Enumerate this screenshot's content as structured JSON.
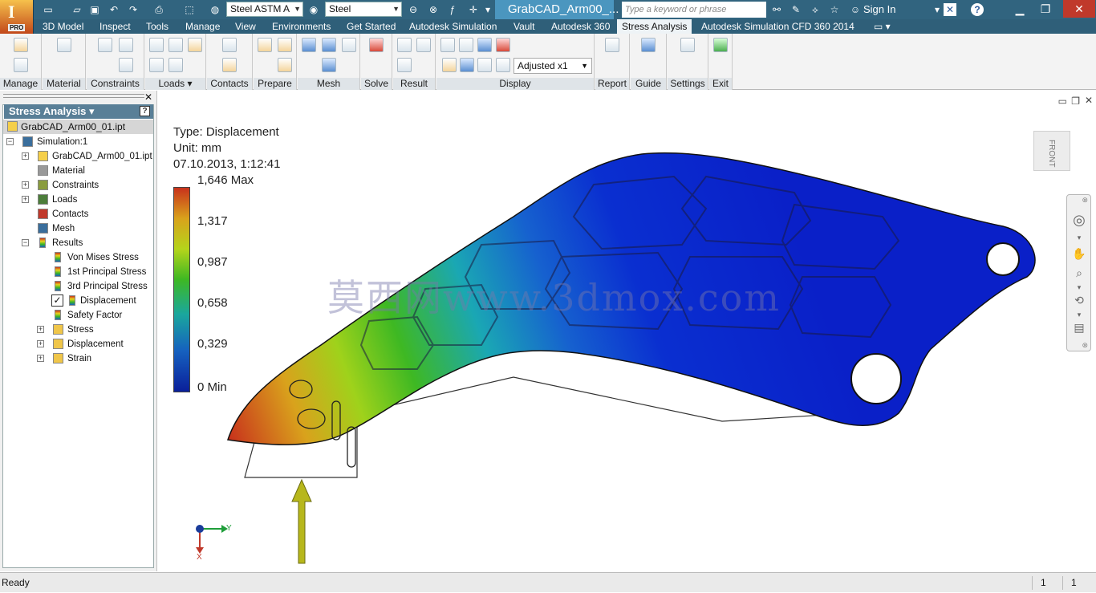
{
  "app": {
    "name": "Inventor",
    "edition": "PRO",
    "document_tab": "GrabCAD_Arm00_..."
  },
  "quick_access": {
    "material_combo": "Steel ASTM A",
    "appearance_combo": "Steel",
    "search_placeholder": "Type a keyword or phrase",
    "sign_in": "Sign In"
  },
  "menu": {
    "tabs": [
      "3D Model",
      "Inspect",
      "Tools",
      "Manage",
      "View",
      "Environments",
      "Get Started",
      "Autodesk Simulation",
      "Vault",
      "Autodesk 360",
      "Stress Analysis",
      "Autodesk Simulation CFD 360 2014"
    ],
    "active": "Stress Analysis"
  },
  "ribbon": {
    "panels": [
      "Manage",
      "Material",
      "Constraints",
      "Loads",
      "Contacts",
      "Prepare",
      "Mesh",
      "Solve",
      "Result",
      "Display",
      "Report",
      "Guide",
      "Settings",
      "Exit"
    ],
    "display_combo": "Adjusted x1"
  },
  "browser": {
    "title": "Stress Analysis",
    "help": "?",
    "root": "GrabCAD_Arm00_01.ipt",
    "nodes": {
      "simulation": "Simulation:1",
      "part": "GrabCAD_Arm00_01.ipt",
      "material": "Material",
      "constraints": "Constraints",
      "loads": "Loads",
      "contacts": "Contacts",
      "mesh": "Mesh",
      "results": "Results",
      "von_mises": "Von Mises Stress",
      "p1": "1st Principal Stress",
      "p3": "3rd Principal Stress",
      "displacement": "Displacement",
      "safety": "Safety Factor",
      "stress": "Stress",
      "displacement2": "Displacement",
      "strain": "Strain"
    },
    "checked": "Displacement"
  },
  "legend": {
    "type": "Type: Displacement",
    "unit": "Unit: mm",
    "datetime": "07.10.2013, 1:12:41",
    "max": "1,646 Max",
    "v1": "1,317",
    "v2": "0,987",
    "v3": "0,658",
    "v4": "0,329",
    "min": "0 Min"
  },
  "legend_colors": [
    "#c8321c",
    "#d9a21c",
    "#b5d41b",
    "#3eb823",
    "#1aa79d",
    "#1661bf",
    "#0a1f9a"
  ],
  "viewcube": "FRONT",
  "triad": {
    "y": "Y",
    "x": "X"
  },
  "watermark": "莫西网www.3dmox.com",
  "status": {
    "text": "Ready",
    "count1": "1",
    "count2": "1"
  }
}
